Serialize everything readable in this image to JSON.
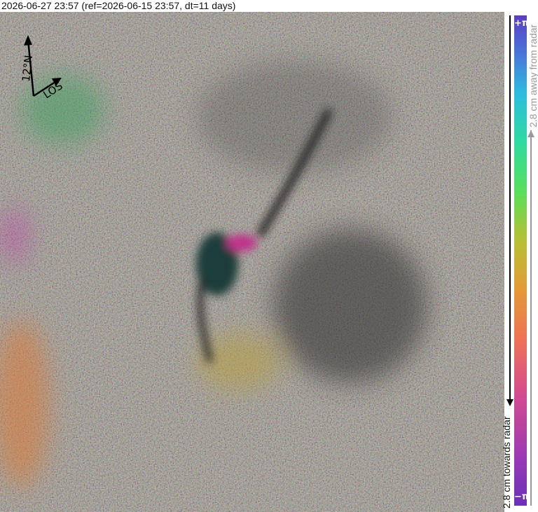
{
  "header": {
    "title": "2026-06-27 23:57 (ref=2026-06-15 23:57, dt=11 days)"
  },
  "compass": {
    "north_label": "12°N",
    "los_label": "LOS"
  },
  "colorbar": {
    "top_label": "+π",
    "bottom_label": "−π",
    "away_text": "2.8 cm away from radar",
    "towards_text": "2.8 cm towards radar",
    "colors": [
      "#6a2fb8",
      "#d24a93",
      "#ee7355",
      "#b8c033",
      "#58df5a",
      "#2bbde0",
      "#5a3ec4"
    ]
  }
}
